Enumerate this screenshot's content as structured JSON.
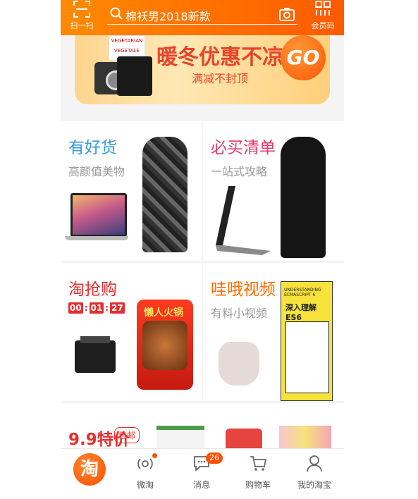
{
  "header": {
    "scan_label": "扫一扫",
    "search_text": "棉袄男2018新款",
    "member_label": "会员码"
  },
  "banner": {
    "title": "暖冬优惠不凉凉",
    "subtitle": "满减不封顶",
    "go_label": "GO",
    "product_text": "VEGETARIAN VEGETALE"
  },
  "cards": {
    "haohuo": {
      "title": "有好货",
      "subtitle": "高颜值美物"
    },
    "bimai": {
      "title": "必买清单",
      "subtitle": "一站式攻略"
    },
    "taoqiang": {
      "title": "淘抢购",
      "timer": [
        "00",
        "01",
        "27"
      ]
    },
    "waoh": {
      "title": "哇哦视频",
      "subtitle": "有料小视频"
    },
    "tejia": {
      "title": "9.9特价",
      "tag": "包邮"
    }
  },
  "products": {
    "hotpot_label": "懒人火锅",
    "book_top": "UNDERSTANDING ECMASCRIPT 6",
    "book_title": "深入理解ES6"
  },
  "tabbar": {
    "home_label": "淘",
    "weitao_label": "微淘",
    "messages_label": "消息",
    "messages_badge": "26",
    "cart_label": "购物车",
    "mine_label": "我的淘宝"
  },
  "colors": {
    "brand": "#ff5a00",
    "accent_blue": "#2d9be2",
    "accent_pink": "#e23a6a",
    "accent_red": "#e82e2e"
  }
}
